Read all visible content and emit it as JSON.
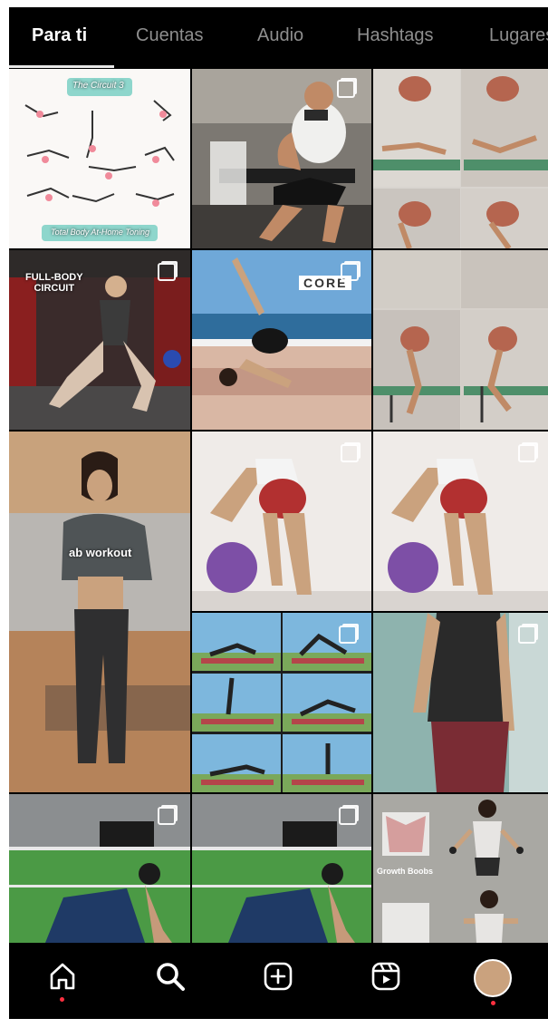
{
  "tabs": [
    {
      "label": "Para ti",
      "active": true
    },
    {
      "label": "Cuentas",
      "active": false
    },
    {
      "label": "Audio",
      "active": false
    },
    {
      "label": "Hashtags",
      "active": false
    },
    {
      "label": "Lugares",
      "active": false
    }
  ],
  "grid": {
    "overlay_texts": {
      "circuit_title": "The Circuit 3",
      "circuit_footer": "Total Body At-Home Toning",
      "full_body": "FULL-BODY\nCIRCUIT",
      "core": "CORE",
      "ab_workout": "ab workout",
      "growth_boobs": "Growth Boobs"
    }
  },
  "bottom_nav": {
    "items": [
      "home-icon",
      "search-icon",
      "create-post-icon",
      "reels-icon",
      "profile-avatar"
    ]
  },
  "colors": {
    "background": "#000000",
    "tab_active": "#ffffff",
    "tab_inactive": "#8e8e8e",
    "notification_dot": "#ff3040"
  }
}
